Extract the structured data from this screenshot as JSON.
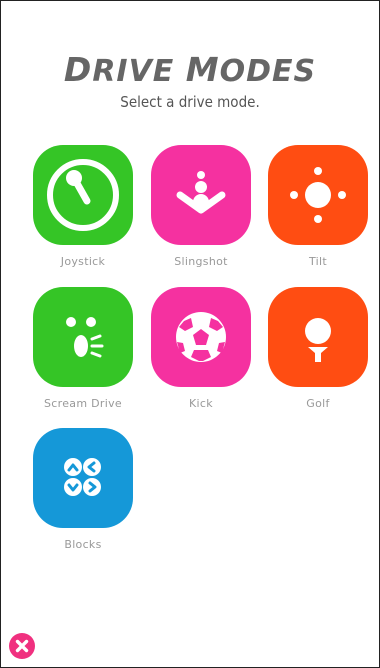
{
  "header": {
    "title_first_letter": "D",
    "title_rest_1": "RIVE ",
    "title_second_letter": "M",
    "title_rest_2": "ODES",
    "subtitle": "Select a drive mode."
  },
  "modes": [
    {
      "label": "Joystick",
      "color": "#35c526",
      "icon": "joystick-icon"
    },
    {
      "label": "Slingshot",
      "color": "#f531a0",
      "icon": "slingshot-icon"
    },
    {
      "label": "Tilt",
      "color": "#ff4d12",
      "icon": "tilt-icon"
    },
    {
      "label": "Scream Drive",
      "color": "#35c526",
      "icon": "scream-icon"
    },
    {
      "label": "Kick",
      "color": "#f531a0",
      "icon": "soccer-ball-icon"
    },
    {
      "label": "Golf",
      "color": "#ff4d12",
      "icon": "golf-ball-icon"
    },
    {
      "label": "Blocks",
      "color": "#1598d8",
      "icon": "blocks-icon"
    }
  ],
  "close": {
    "icon": "close-icon",
    "color": "#f0307f"
  }
}
